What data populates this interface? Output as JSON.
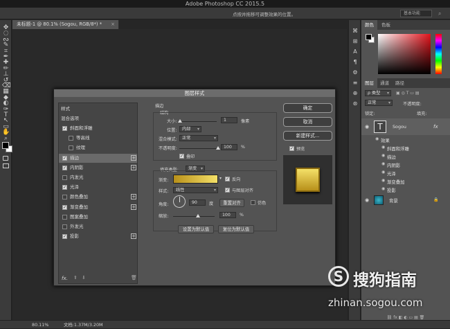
{
  "app": {
    "title": "Adobe Photoshop CC 2015.5"
  },
  "options_bar": {
    "hint": "点按并拖移可调整效果的位置。",
    "workspace": "基本功能"
  },
  "document": {
    "tab_label": "未标题-1 @ 80.1% (Sogou, RGB/8*) *",
    "close_glyph": "×"
  },
  "status_bar": {
    "zoom": "80.11%",
    "doc_info": "文档:1.37M/3.20M"
  },
  "tools": [
    "move-icon",
    "marquee-icon",
    "lasso-icon",
    "quick-select-icon",
    "crop-icon",
    "eyedropper-icon",
    "healing-icon",
    "brush-icon",
    "stamp-icon",
    "history-brush-icon",
    "eraser-icon",
    "gradient-icon",
    "blur-icon",
    "dodge-icon",
    "pen-icon",
    "type-icon",
    "path-select-icon",
    "shape-icon",
    "hand-icon",
    "zoom-icon"
  ],
  "tool_glyphs": [
    "✥",
    "◌",
    "ᔓ",
    "✎",
    "⌗",
    "✒",
    "✚",
    "✏",
    "⊥",
    "↺",
    "⌫",
    "▦",
    "◆",
    "◐",
    "✑",
    "T",
    "↖",
    "▭",
    "✋",
    "⌕"
  ],
  "right_icons": [
    "⌘",
    "⊞",
    "A",
    "¶",
    "⚙",
    "≡",
    "⊕",
    "⊛"
  ],
  "panels": {
    "color_tabs": [
      "颜色",
      "色板"
    ],
    "layers_tabs": [
      "图层",
      "通道",
      "路径"
    ],
    "kind_label": "ρ 类型",
    "blend_mode": "正常",
    "opacity_label": "不透明度:",
    "lock_label": "锁定:",
    "fill_label": "填充:",
    "layers": [
      {
        "name": "Sogou",
        "fx": "fx",
        "visible": true
      },
      {
        "name": "效果",
        "sub": true
      },
      {
        "name": "斜面和浮雕",
        "sub2": true
      },
      {
        "name": "描边",
        "sub2": true
      },
      {
        "name": "内阴影",
        "sub2": true
      },
      {
        "name": "光泽",
        "sub2": true
      },
      {
        "name": "渐变叠加",
        "sub2": true
      },
      {
        "name": "投影",
        "sub2": true
      },
      {
        "name": "背景",
        "visible": true,
        "locked": true
      }
    ]
  },
  "dialog": {
    "title": "图层样式",
    "styles_header": "样式",
    "blend_options": "混合选项",
    "effects": [
      {
        "label": "斜面和浮雕",
        "checked": true,
        "plus": false
      },
      {
        "label": "等高线",
        "checked": false,
        "plus": false,
        "indent": true
      },
      {
        "label": "纹理",
        "checked": false,
        "plus": false,
        "indent": true
      },
      {
        "label": "描边",
        "checked": true,
        "plus": true,
        "selected": true
      },
      {
        "label": "内阴影",
        "checked": true,
        "plus": true
      },
      {
        "label": "内发光",
        "checked": false,
        "plus": false
      },
      {
        "label": "光泽",
        "checked": true,
        "plus": false
      },
      {
        "label": "颜色叠加",
        "checked": false,
        "plus": true
      },
      {
        "label": "渐变叠加",
        "checked": true,
        "plus": true
      },
      {
        "label": "图案叠加",
        "checked": false,
        "plus": false
      },
      {
        "label": "外发光",
        "checked": false,
        "plus": false
      },
      {
        "label": "投影",
        "checked": true,
        "plus": true
      }
    ],
    "fx_label": "fx.",
    "stroke": {
      "section": "描边",
      "structure": "结构",
      "size_label": "大小:",
      "size_value": "1",
      "size_unit": "像素",
      "position_label": "位置:",
      "position_value": "内部",
      "blend_label": "混合模式:",
      "blend_value": "正常",
      "opacity_label": "不透明度:",
      "opacity_value": "100",
      "opacity_unit": "%",
      "overprint_label": "叠印",
      "fill_type_label": "填充类型:",
      "fill_type_value": "渐变",
      "gradient_label": "渐变:",
      "reverse_label": "反向",
      "style_label": "样式:",
      "style_value": "线性",
      "align_label": "与图层对齐",
      "angle_label": "角度:",
      "angle_value": "90",
      "angle_unit": "度",
      "reset_align": "重置对齐",
      "dither_label": "仿色",
      "scale_label": "缩放:",
      "scale_value": "100",
      "scale_unit": "%",
      "set_default": "设置为默认值",
      "reset_default": "复位为默认值"
    },
    "buttons": {
      "ok": "确定",
      "cancel": "取消",
      "new_style": "新建样式...",
      "preview": "预览"
    },
    "colors": {
      "gradient_start": "#b8901a",
      "gradient_end": "#f4e068"
    }
  },
  "watermark": {
    "brand": "搜狗指南",
    "url": "zhinan.sogou.com"
  }
}
